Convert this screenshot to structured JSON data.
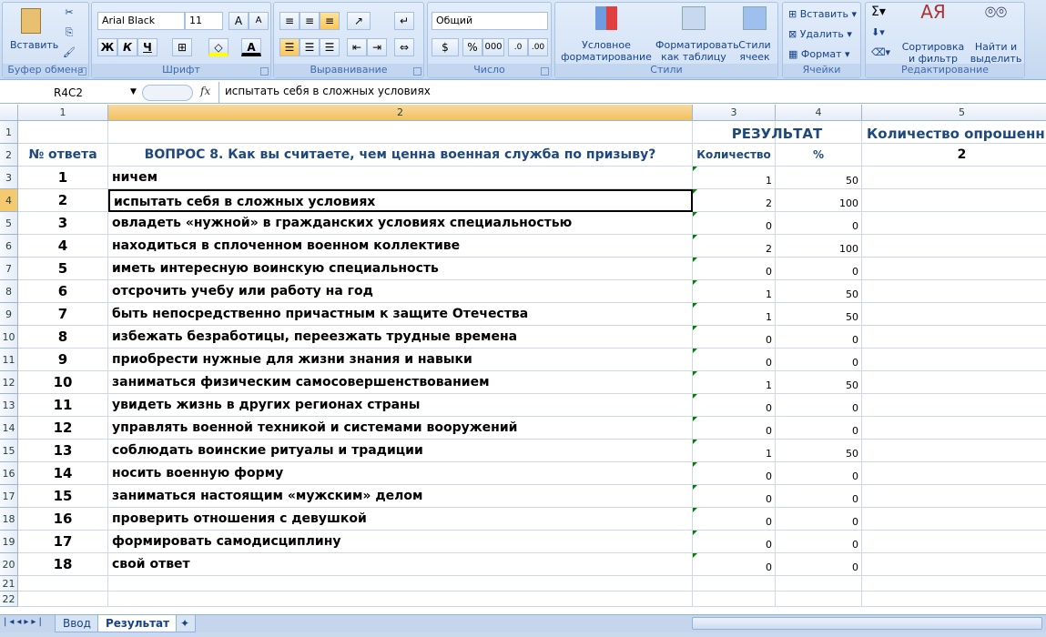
{
  "ribbon": {
    "clipboard": {
      "label": "Буфер обмена",
      "paste": "Вставить"
    },
    "font": {
      "label": "Шрифт",
      "font_name": "Arial Black",
      "font_size": "11",
      "bold": "Ж",
      "italic": "К",
      "underline": "Ч"
    },
    "alignment": {
      "label": "Выравнивание"
    },
    "number": {
      "label": "Число",
      "format": "Общий",
      "percent": "%",
      "thousands": "000"
    },
    "styles": {
      "label": "Стили",
      "conditional": [
        "Условное",
        "форматирование"
      ],
      "as_table": [
        "Форматировать",
        "как таблицу"
      ],
      "cell_styles": [
        "Стили",
        "ячеек"
      ]
    },
    "cells": {
      "label": "Ячейки",
      "insert": "Вставить",
      "delete": "Удалить",
      "format": "Формат"
    },
    "editing": {
      "label": "Редактирование",
      "sort": [
        "Сортировка",
        "и фильтр"
      ],
      "find": [
        "Найти и",
        "выделить"
      ]
    }
  },
  "formula_bar": {
    "name_box": "R4C2",
    "fx": "fx",
    "formula": "испытать себя в сложных условиях"
  },
  "columns": [
    "1",
    "2",
    "3",
    "4",
    "5"
  ],
  "header": {
    "result": "РЕЗУЛЬТАТ",
    "respondents_label": "Количество опрошенн",
    "answer_no": "№ ответа",
    "question": "ВОПРОС 8. Как вы считаете, чем ценна военная служба по призыву?",
    "count": "Количество",
    "percent": "%",
    "respondents": "2"
  },
  "rows": [
    {
      "n": "1",
      "text": "ничем",
      "count": "1",
      "pct": "50"
    },
    {
      "n": "2",
      "text": "испытать себя в сложных условиях",
      "count": "2",
      "pct": "100"
    },
    {
      "n": "3",
      "text": "овладеть «нужной» в гражданских условиях специальностью",
      "count": "0",
      "pct": "0"
    },
    {
      "n": "4",
      "text": "находиться в сплоченном военном коллективе",
      "count": "2",
      "pct": "100"
    },
    {
      "n": "5",
      "text": "иметь интересную воинскую специальность",
      "count": "0",
      "pct": "0"
    },
    {
      "n": "6",
      "text": "отсрочить учебу или работу на год",
      "count": "1",
      "pct": "50"
    },
    {
      "n": "7",
      "text": "быть непосредственно причастным к защите Отечества",
      "count": "1",
      "pct": "50"
    },
    {
      "n": "8",
      "text": "избежать безработицы, переезжать трудные времена",
      "count": "0",
      "pct": "0"
    },
    {
      "n": "9",
      "text": "приобрести нужные для жизни знания и навыки",
      "count": "0",
      "pct": "0"
    },
    {
      "n": "10",
      "text": "заниматься физическим самосовершенствованием",
      "count": "1",
      "pct": "50"
    },
    {
      "n": "11",
      "text": "увидеть жизнь в других регионах страны",
      "count": "0",
      "pct": "0"
    },
    {
      "n": "12",
      "text": "управлять военной техникой и системами вооружений",
      "count": "0",
      "pct": "0"
    },
    {
      "n": "13",
      "text": "соблюдать воинские ритуалы и традиции",
      "count": "1",
      "pct": "50"
    },
    {
      "n": "14",
      "text": "носить военную форму",
      "count": "0",
      "pct": "0"
    },
    {
      "n": "15",
      "text": "заниматься настоящим «мужским» делом",
      "count": "0",
      "pct": "0"
    },
    {
      "n": "16",
      "text": "проверить отношения с девушкой",
      "count": "0",
      "pct": "0"
    },
    {
      "n": "17",
      "text": "формировать самодисциплину",
      "count": "0",
      "pct": "0"
    },
    {
      "n": "18",
      "text": "свой ответ",
      "count": "0",
      "pct": "0"
    }
  ],
  "row_numbers": [
    "1",
    "2",
    "3",
    "4",
    "5",
    "6",
    "7",
    "8",
    "9",
    "10",
    "11",
    "12",
    "13",
    "14",
    "15",
    "16",
    "17",
    "18",
    "19",
    "20",
    "21",
    "22"
  ],
  "sheets": [
    {
      "label": "Ввод"
    },
    {
      "label": "Результат"
    }
  ],
  "active_sheet": "Результат",
  "selected_cell": "R4C2"
}
